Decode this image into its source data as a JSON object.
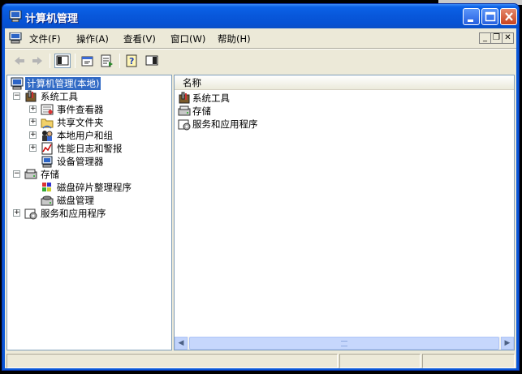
{
  "window": {
    "title": "计算机管理"
  },
  "menu": {
    "items": [
      "文件(F)",
      "操作(A)",
      "查看(V)",
      "窗口(W)",
      "帮助(H)"
    ]
  },
  "toolbar": {
    "buttons": [
      "back-icon",
      "forward-icon",
      "show-hide-tree-icon",
      "properties-icon",
      "export-list-icon",
      "help-icon",
      "action-pane-icon"
    ]
  },
  "tree": {
    "root": "计算机管理(本地)",
    "items": [
      {
        "label": "系统工具",
        "icon": "toolbox-icon"
      },
      {
        "label": "事件查看器",
        "icon": "event-viewer-icon"
      },
      {
        "label": "共享文件夹",
        "icon": "shared-folder-icon"
      },
      {
        "label": "本地用户和组",
        "icon": "users-icon"
      },
      {
        "label": "性能日志和警报",
        "icon": "performance-icon"
      },
      {
        "label": "设备管理器",
        "icon": "device-manager-icon"
      },
      {
        "label": "存储",
        "icon": "storage-icon"
      },
      {
        "label": "磁盘碎片整理程序",
        "icon": "defrag-icon"
      },
      {
        "label": "磁盘管理",
        "icon": "disk-management-icon"
      },
      {
        "label": "服务和应用程序",
        "icon": "services-icon"
      }
    ]
  },
  "list": {
    "column": "名称",
    "items": [
      "系统工具",
      "存储",
      "服务和应用程序"
    ]
  },
  "colors": {
    "selection": "#316ac5",
    "titlebar": "#0857da",
    "face": "#ece9d8"
  }
}
